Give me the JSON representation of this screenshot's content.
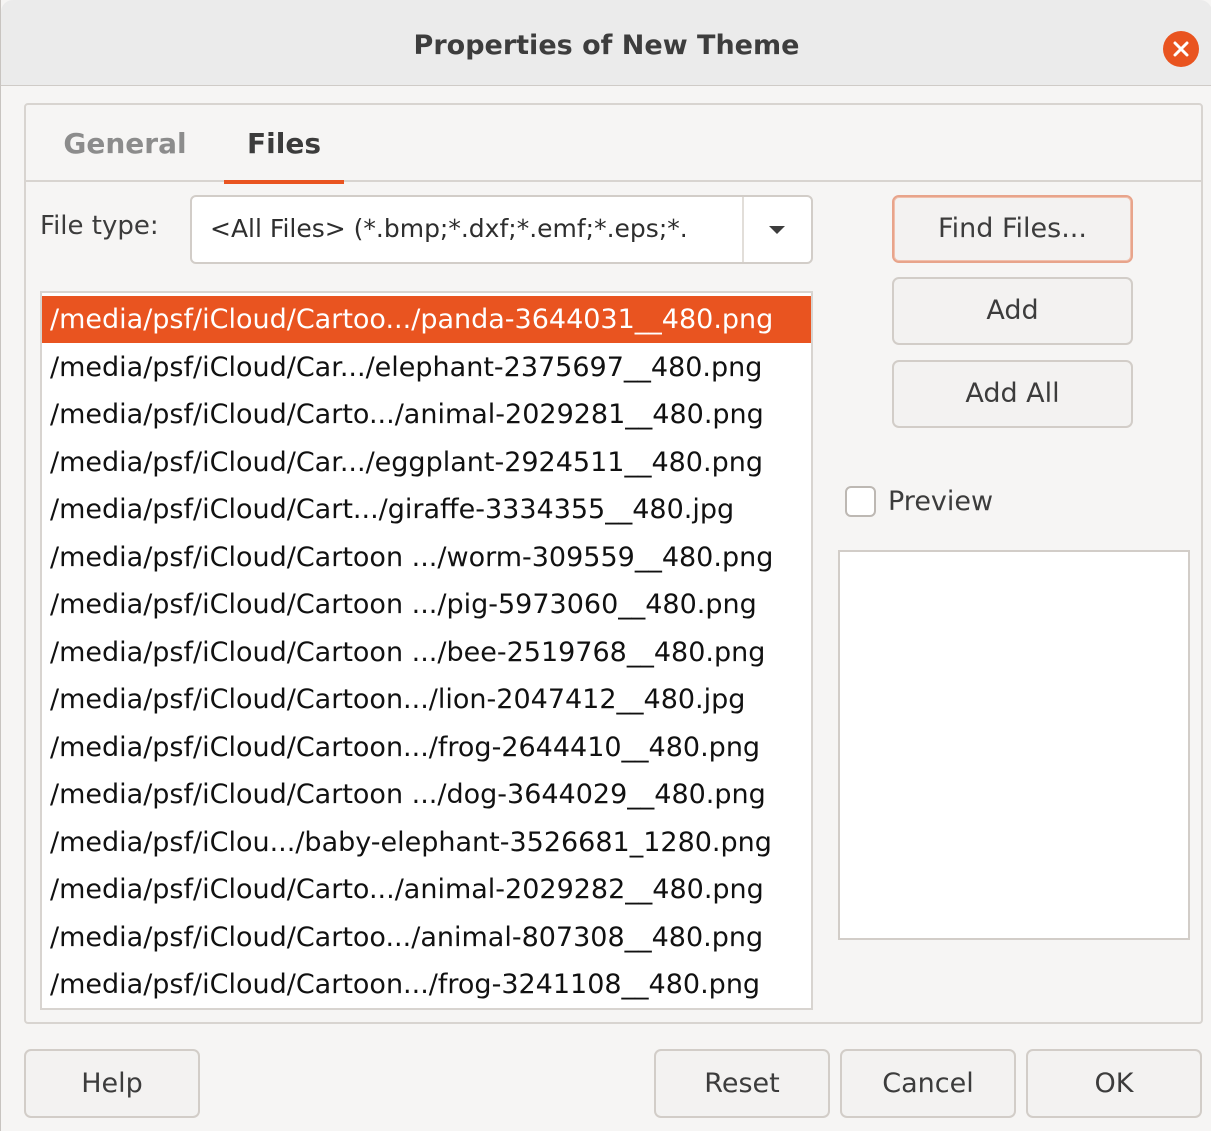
{
  "dialog": {
    "title": "Properties of New Theme"
  },
  "tabs": [
    {
      "label": "General",
      "active": false
    },
    {
      "label": "Files",
      "active": true
    }
  ],
  "file_type": {
    "label": "File type:",
    "value": "<All Files> (*.bmp;*.dxf;*.emf;*.eps;*."
  },
  "files": [
    "/media/psf/iCloud/Cartoo.../panda-3644031__480.png",
    "/media/psf/iCloud/Car.../elephant-2375697__480.png",
    "/media/psf/iCloud/Carto.../animal-2029281__480.png",
    "/media/psf/iCloud/Car.../eggplant-2924511__480.png",
    "/media/psf/iCloud/Cart.../giraffe-3334355__480.jpg",
    "/media/psf/iCloud/Cartoon .../worm-309559__480.png",
    "/media/psf/iCloud/Cartoon .../pig-5973060__480.png",
    "/media/psf/iCloud/Cartoon .../bee-2519768__480.png",
    "/media/psf/iCloud/Cartoon.../lion-2047412__480.jpg",
    "/media/psf/iCloud/Cartoon.../frog-2644410__480.png",
    "/media/psf/iCloud/Cartoon .../dog-3644029__480.png",
    "/media/psf/iClou.../baby-elephant-3526681_1280.png",
    "/media/psf/iCloud/Carto.../animal-2029282__480.png",
    "/media/psf/iCloud/Cartoo.../animal-807308__480.png",
    "/media/psf/iCloud/Cartoon.../frog-3241108__480.png"
  ],
  "selected_file_index": 0,
  "side_buttons": {
    "find_files": "Find Files...",
    "add": "Add",
    "add_all": "Add All"
  },
  "preview": {
    "label": "Preview",
    "checked": false
  },
  "footer_buttons": {
    "help": "Help",
    "reset": "Reset",
    "cancel": "Cancel",
    "ok": "OK"
  },
  "colors": {
    "accent": "#e95420",
    "window_bg": "#f6f5f4",
    "titlebar_bg": "#ebebeb"
  }
}
